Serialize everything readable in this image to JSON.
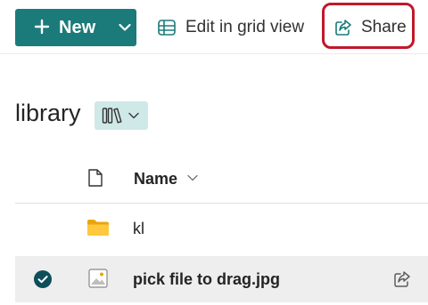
{
  "toolbar": {
    "new_label": "New",
    "edit_grid_label": "Edit in grid view",
    "share_label": "Share",
    "accent": "#1b7b7a",
    "highlight_color": "#c0182a"
  },
  "library": {
    "title": "library",
    "view_icon": "library-view-icon"
  },
  "list": {
    "header": {
      "name_label": "Name"
    },
    "items": [
      {
        "name": "kl",
        "type": "folder",
        "icon": "folder-icon",
        "selected": false
      },
      {
        "name": "pick file to drag.jpg",
        "type": "image",
        "icon": "image-file-icon",
        "selected": true
      }
    ]
  }
}
